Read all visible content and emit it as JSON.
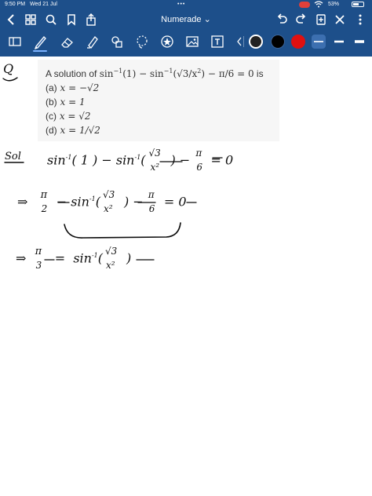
{
  "status": {
    "time": "9:50 PM",
    "date": "Wed 21 Jul",
    "battery": "53%",
    "battery_level": 0.53
  },
  "nav": {
    "title": "Numerade",
    "title_chevron": "⌄"
  },
  "question": {
    "prefix": "A solution of ",
    "equation_a": "sin",
    "sup": "−1",
    "equation_b": "(1) − sin",
    "equation_c": "(√3/x",
    "sq": "2",
    "equation_d": ") − π/6 = 0",
    "suffix": " is",
    "options": [
      {
        "label": "(a)",
        "text": "x = −√2"
      },
      {
        "label": "(b)",
        "text": "x = 1"
      },
      {
        "label": "(c)",
        "text": "x = √2"
      },
      {
        "label": "(d)",
        "text": "x = 1/√2"
      }
    ]
  },
  "handwriting": {
    "q_mark": "Q",
    "sol_mark": "Sol",
    "line1": "sin⁻¹(1) − sin⁻¹(√3/x²) − π/6 = 0",
    "line2": "⇒ π/2 − sin⁻¹(√3/x²) − π/6 = 0",
    "line3": "⇒ π/3 = sin⁻¹(√3/x²)"
  },
  "colors": {
    "bar": "#1d4f8a",
    "swatch_dark": "#222222",
    "swatch_black": "#000000",
    "swatch_red": "#e01010",
    "ink": "#0a0a0a"
  },
  "tools": [
    "sidebar-icon",
    "pen-icon",
    "eraser-icon",
    "highlighter-icon",
    "shapes-icon",
    "lasso-icon",
    "sticker-icon",
    "image-icon",
    "text-icon"
  ]
}
